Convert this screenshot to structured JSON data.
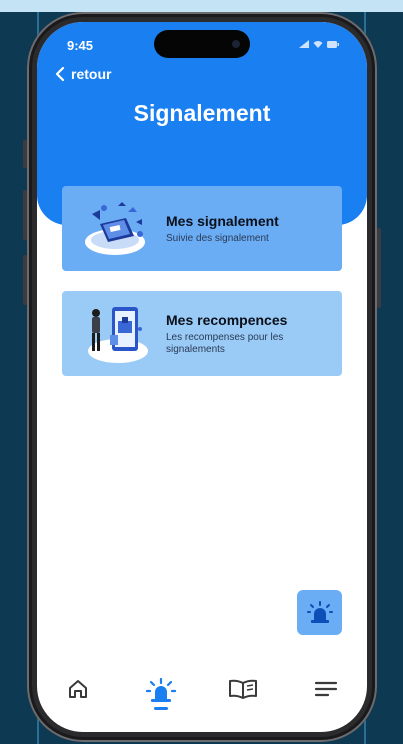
{
  "status_bar": {
    "time": "9:45"
  },
  "header": {
    "back_label": "retour",
    "title": "Signalement"
  },
  "cards": [
    {
      "title": "Mes signalement",
      "subtitle": "Suivie des signalement"
    },
    {
      "title": "Mes recompences",
      "subtitle": "Les recompenses pour les signalements"
    }
  ],
  "nav": {
    "items": [
      {
        "icon": "home-icon",
        "active": false
      },
      {
        "icon": "siren-icon",
        "active": true
      },
      {
        "icon": "book-icon",
        "active": false
      },
      {
        "icon": "menu-icon",
        "active": false
      }
    ]
  },
  "colors": {
    "primary": "#1a7ff0",
    "card1": "#6aadf5",
    "card2": "#9acbf6",
    "fab": "#6aadf5"
  }
}
